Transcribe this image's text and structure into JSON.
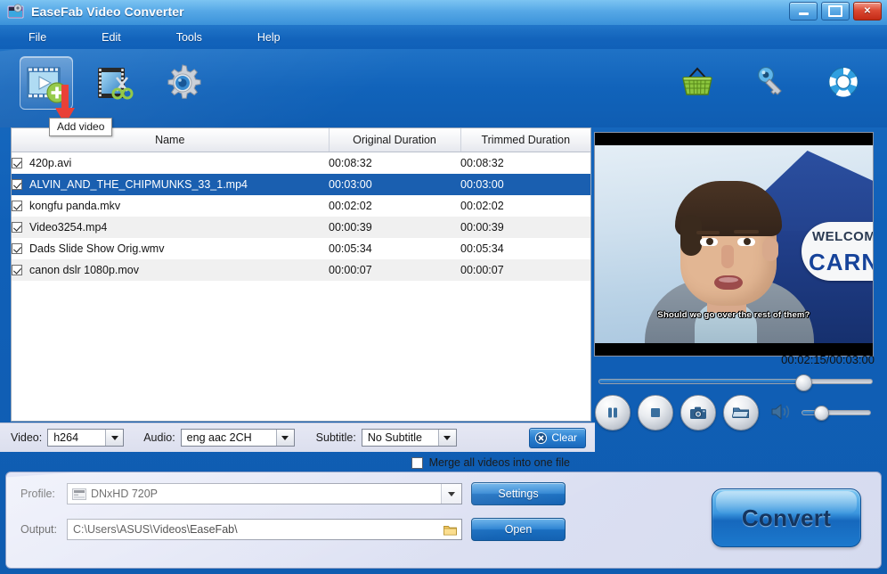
{
  "window": {
    "title": "EaseFab Video Converter",
    "buttons": {
      "minimize": "minimize",
      "maximize": "maximize",
      "close": "close"
    }
  },
  "menu": {
    "items": [
      "File",
      "Edit",
      "Tools",
      "Help"
    ]
  },
  "toolbar": {
    "left": [
      {
        "name": "add-video",
        "tooltip": "Add video"
      },
      {
        "name": "edit-video",
        "tooltip": "Edit"
      },
      {
        "name": "settings",
        "tooltip": "Settings"
      }
    ],
    "right": [
      {
        "name": "buy",
        "tooltip": "Buy"
      },
      {
        "name": "register",
        "tooltip": "Register"
      },
      {
        "name": "support",
        "tooltip": "Support"
      }
    ],
    "tooltip_visible": "Add video"
  },
  "filelist": {
    "columns": [
      "Name",
      "Original Duration",
      "Trimmed Duration"
    ],
    "rows": [
      {
        "checked": true,
        "name": "420p.avi",
        "original": "00:08:32",
        "trimmed": "00:08:32",
        "selected": false
      },
      {
        "checked": true,
        "name": "ALVIN_AND_THE_CHIPMUNKS_33_1.mp4",
        "original": "00:03:00",
        "trimmed": "00:03:00",
        "selected": true
      },
      {
        "checked": true,
        "name": "kongfu panda.mkv",
        "original": "00:02:02",
        "trimmed": "00:02:02",
        "selected": false
      },
      {
        "checked": true,
        "name": "Video3254.mp4",
        "original": "00:00:39",
        "trimmed": "00:00:39",
        "selected": false
      },
      {
        "checked": true,
        "name": "Dads Slide Show Orig.wmv",
        "original": "00:05:34",
        "trimmed": "00:05:34",
        "selected": false
      },
      {
        "checked": true,
        "name": "canon dslr 1080p.mov",
        "original": "00:00:07",
        "trimmed": "00:00:07",
        "selected": false
      }
    ]
  },
  "streams": {
    "video_label": "Video:",
    "video_value": "h264",
    "audio_label": "Audio:",
    "audio_value": "eng aac 2CH",
    "subtitle_label": "Subtitle:",
    "subtitle_value": "No Subtitle",
    "clear_label": "Clear"
  },
  "merge": {
    "label": "Merge all videos into one file",
    "checked": false
  },
  "profile": {
    "label": "Profile:",
    "value": "DNxHD 720P",
    "settings_button": "Settings"
  },
  "output": {
    "label": "Output:",
    "value": "C:\\Users\\ASUS\\Videos\\EaseFab\\",
    "open_button": "Open"
  },
  "convert": {
    "label": "Convert"
  },
  "preview": {
    "subtitle_text": "Should we go over the rest of them?",
    "sign_line1": "WELCOME",
    "sign_line2": "CARNIVAL",
    "time": "00:02:15/00:03:00",
    "seek_percent": 74,
    "volume_percent": 25,
    "controls": [
      "pause",
      "stop",
      "snapshot",
      "open-folder",
      "volume"
    ]
  },
  "colors": {
    "titlebar_light": "#7cc4f2",
    "toolbar_blue": "#1060b8",
    "selection_blue": "#1a5fb0",
    "accent_button": "#2a7fd0",
    "panel_lavender": "#dfe3f5",
    "arrow_red": "#e8342a"
  }
}
